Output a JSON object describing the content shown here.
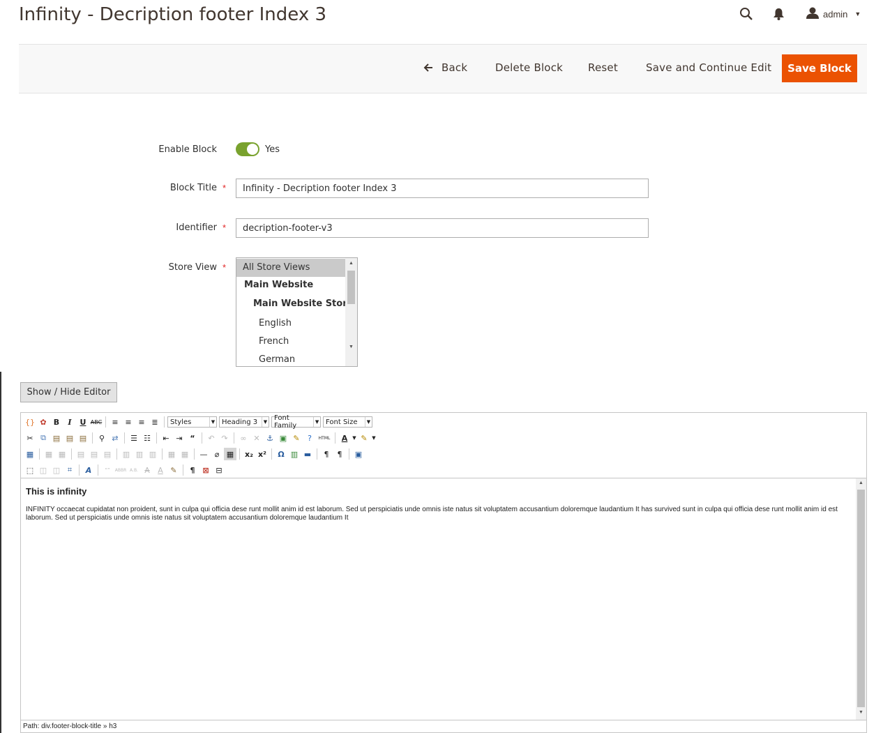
{
  "header": {
    "title": "Infinity - Decription footer Index 3",
    "user_name": "admin"
  },
  "actions": {
    "back": "Back",
    "delete": "Delete Block",
    "reset": "Reset",
    "save_continue": "Save and Continue Edit",
    "save": "Save Block"
  },
  "form": {
    "enable_label": "Enable Block",
    "enable_value": "Yes",
    "title_label": "Block Title",
    "title_value": "Infinity - Decription footer Index 3",
    "identifier_label": "Identifier",
    "identifier_value": "decription-footer-v3",
    "store_label": "Store View",
    "required_mark": "*",
    "store_options": [
      "All Store Views",
      "Main Website",
      "Main Website Store",
      "English",
      "French",
      "German"
    ]
  },
  "editor": {
    "toggle_label": "Show / Hide Editor",
    "styles": "Styles",
    "format": "Heading 3",
    "font_family": "Font Family",
    "font_size": "Font Size",
    "html_label": "HTML",
    "heading": "This is infinity",
    "body": "INFINITY occaecat cupidatat non proident, sunt in culpa qui officia dese runt mollit anim id est laborum. Sed ut perspiciatis unde omnis iste natus sit voluptatem accusantium doloremque laudantium It has survived sunt in culpa qui officia dese runt mollit anim id est laborum. Sed ut perspiciatis unde omnis iste natus sit voluptatem accusantium doloremque laudantium It",
    "path": "Path: div.footer-block-title » h3"
  },
  "colors": {
    "primary_button": "#eb5202",
    "toggle_on": "#79a22e"
  }
}
